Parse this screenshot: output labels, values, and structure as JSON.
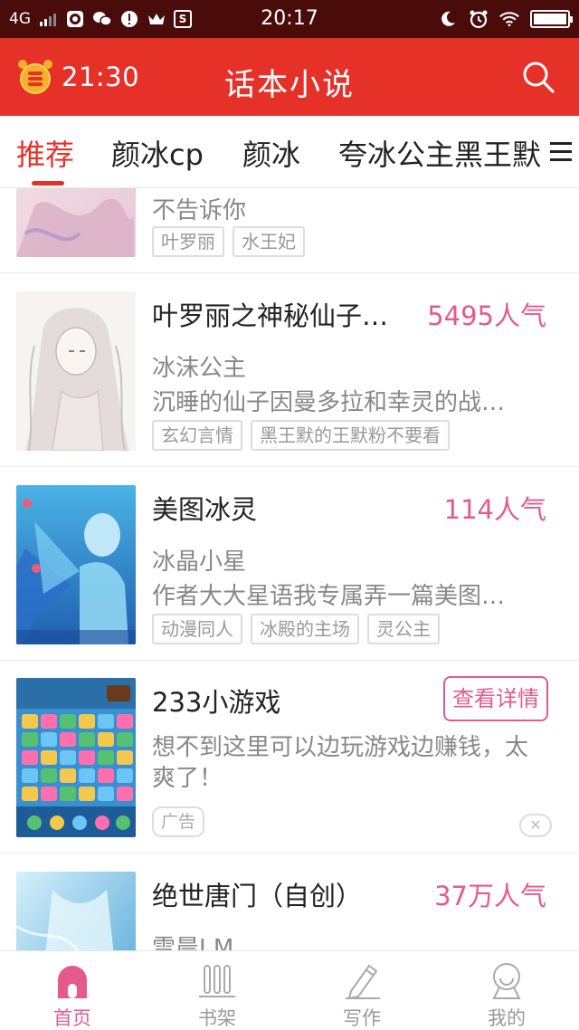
{
  "status_bar": {
    "network": "4G",
    "time": "20:17",
    "sim_icon_letter": "S"
  },
  "header": {
    "alarm_time": "21:30",
    "title": "话本小说"
  },
  "tabs": [
    {
      "label": "推荐",
      "active": true
    },
    {
      "label": "颜冰cp",
      "active": false
    },
    {
      "label": "颜冰",
      "active": false
    },
    {
      "label": "夸冰公主黑王默",
      "active": false
    }
  ],
  "feed": {
    "items": [
      {
        "title": "",
        "popularity": "",
        "author": "不告诉你",
        "description": "",
        "tags": [
          "叶罗丽",
          "水王妃"
        ]
      },
      {
        "title": "叶罗丽之神秘仙子…",
        "popularity": "5495人气",
        "author": "冰沫公主",
        "description": "沉睡的仙子因曼多拉和幸灵的战…",
        "tags": [
          "玄幻言情",
          "黑王默的王默粉不要看"
        ]
      },
      {
        "title": "美图冰灵",
        "popularity": "114人气",
        "author": "冰晶小星",
        "description": "作者大大星语我专属弄一篇美图…",
        "tags": [
          "动漫同人",
          "冰殿的主场",
          "灵公主"
        ]
      },
      {
        "title": "绝世唐门（自创）",
        "popularity": "37万人气",
        "author": "雪晨J.M",
        "description": "",
        "tags": []
      }
    ],
    "ad": {
      "title": "233小游戏",
      "button": "查看详情",
      "description": "想不到这里可以边玩游戏边赚钱，太爽了！",
      "tag": "广告",
      "close": "✕"
    }
  },
  "bottom_nav": [
    {
      "label": "首页",
      "icon": "home-icon",
      "active": true
    },
    {
      "label": "书架",
      "icon": "bookshelf-icon",
      "active": false
    },
    {
      "label": "写作",
      "icon": "pencil-icon",
      "active": false
    },
    {
      "label": "我的",
      "icon": "profile-icon",
      "active": false
    }
  ],
  "colors": {
    "status_bar": "#4a0b0b",
    "header": "#e63129",
    "accent_pink": "#e55a8c",
    "gray_text": "#888888"
  }
}
